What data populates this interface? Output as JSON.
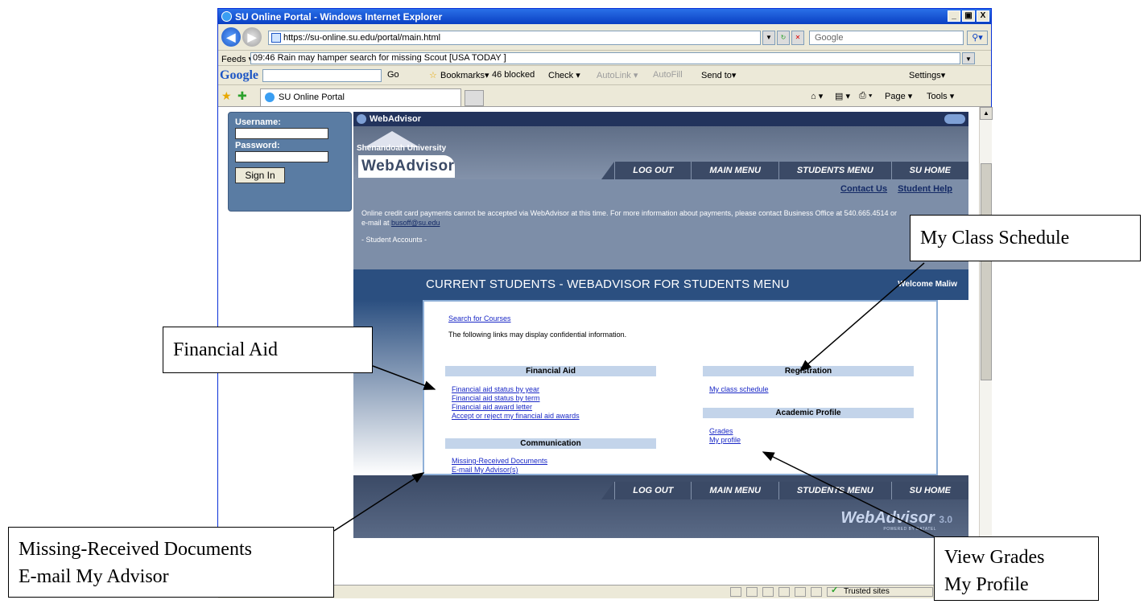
{
  "window": {
    "title": "SU Online Portal - Windows Internet Explorer",
    "buttons": [
      "_",
      "▣",
      "X"
    ]
  },
  "address_bar": {
    "url": "https://su-online.su.edu/portal/main.html",
    "search_placeholder": "Google",
    "back_icon": "back-arrow-icon",
    "forward_icon": "forward-arrow-icon"
  },
  "feeds_bar": {
    "label": "Feeds ▾",
    "ticker": "09:46  Rain may hamper search for missing Scout  [USA TODAY ]"
  },
  "google_toolbar": {
    "logo": "Google",
    "go": "Go",
    "bookmarks": "Bookmarks▾",
    "blocked": "46 blocked",
    "check": "Check ▾",
    "autolink": "AutoLink ▾",
    "autofill": "AutoFill",
    "send_to": "Send to▾",
    "settings": "Settings▾"
  },
  "tab_bar": {
    "tab_label": "SU Online Portal",
    "page_menu": "Page ▾",
    "tools_menu": "Tools ▾"
  },
  "login": {
    "username_label": "Username:",
    "password_label": "Password:",
    "signin_label": "Sign In"
  },
  "webadvisor": {
    "header": "WebAdvisor",
    "university": "Shenandoah University",
    "logo_text": "WebAdvisor",
    "nav": [
      "LOG OUT",
      "MAIN MENU",
      "STUDENTS MENU",
      "SU HOME"
    ],
    "links": {
      "contact": "Contact Us",
      "help": "Student Help"
    },
    "notice_line1": "Online credit card payments cannot be accepted via WebAdvisor at this time. For more information about payments, please contact Business Office at 540.665.4514 or",
    "notice_line2_prefix": "e-mail at ",
    "notice_email": "busoff@su.edu",
    "notice_sig": "- Student Accounts -",
    "band_title": "CURRENT STUDENTS - WEBADVISOR FOR STUDENTS MENU",
    "welcome": "Welcome Maliw",
    "panel": {
      "search_link": "Search for Courses",
      "confidential_note": "The following links may display confidential information.",
      "financial_aid": {
        "header": "Financial Aid",
        "items": [
          "Financial aid status by year",
          "Financial aid status by term",
          "Financial aid award letter",
          "Accept or reject my financial aid awards"
        ]
      },
      "communication": {
        "header": "Communication",
        "items": [
          "Missing-Received Documents",
          "E-mail My Advisor(s)"
        ]
      },
      "registration": {
        "header": "Registration",
        "items": [
          "My class schedule"
        ]
      },
      "academic_profile": {
        "header": "Academic Profile",
        "items": [
          "Grades",
          "My profile"
        ]
      }
    },
    "footer_brand": "WebAdvisor",
    "footer_version": "3.0",
    "footer_powered": "POWERED BY DATATEL"
  },
  "status_bar": {
    "zone": "Trusted sites"
  },
  "callouts": {
    "class_schedule": "My Class Schedule",
    "financial_aid": "Financial Aid",
    "missing_docs_line1": "Missing-Received Documents",
    "missing_docs_line2": "E-mail My Advisor",
    "grades_line1": "View Grades",
    "grades_line2": "My Profile"
  },
  "colors": {
    "titlebar": "#0a3fc2",
    "webadvisor_dark": "#22335c",
    "band": "#2b4f80",
    "link": "#1a28c6",
    "panel_header": "#c3d4ea"
  }
}
